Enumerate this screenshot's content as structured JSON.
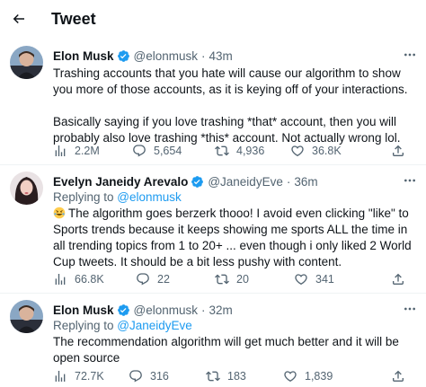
{
  "header": {
    "title": "Tweet"
  },
  "tweets": [
    {
      "name": "Elon Musk",
      "handle": "@elonmusk",
      "sep": "·",
      "time": "43m",
      "text": "Trashing accounts that you hate will cause our algorithm to show you more of those accounts, as it is keying off of your interactions.\n\nBasically saying if you love trashing *that* account, then you will probably also love trashing *this* account. Not actually wrong lol.",
      "views": "2.2M",
      "replies": "5,654",
      "retweets": "4,936",
      "likes": "36.8K"
    },
    {
      "name": "Evelyn Janeidy Arevalo",
      "handle": "@JaneidyEve",
      "sep": "·",
      "time": "36m",
      "reply_prefix": "Replying to ",
      "reply_to": "@elonmusk",
      "text": "The algorithm goes berzerk thooo! I avoid even clicking \"like\" to Sports trends because it keeps showing me sports ALL the time in all trending topics from 1 to 20+ ... even though i only liked 2 World Cup tweets. It should be a bit less pushy with content.",
      "views": "66.8K",
      "replies": "22",
      "retweets": "20",
      "likes": "341"
    },
    {
      "name": "Elon Musk",
      "handle": "@elonmusk",
      "sep": "·",
      "time": "32m",
      "reply_prefix": "Replying to ",
      "reply_to": "@JaneidyEve",
      "text": "The recommendation algorithm will get much better and it will be open source",
      "views": "72.7K",
      "replies": "316",
      "retweets": "183",
      "likes": "1,839"
    }
  ],
  "colors": {
    "verified": "#1d9bf0",
    "link": "#1d9bf0",
    "secondary": "#536471",
    "text": "#0f1419"
  },
  "icons": {
    "back": "arrow-left-icon",
    "more": "more-icon",
    "verified": "verified-badge-icon",
    "views": "views-icon",
    "reply": "reply-icon",
    "retweet": "retweet-icon",
    "like": "like-icon",
    "share": "share-icon"
  }
}
